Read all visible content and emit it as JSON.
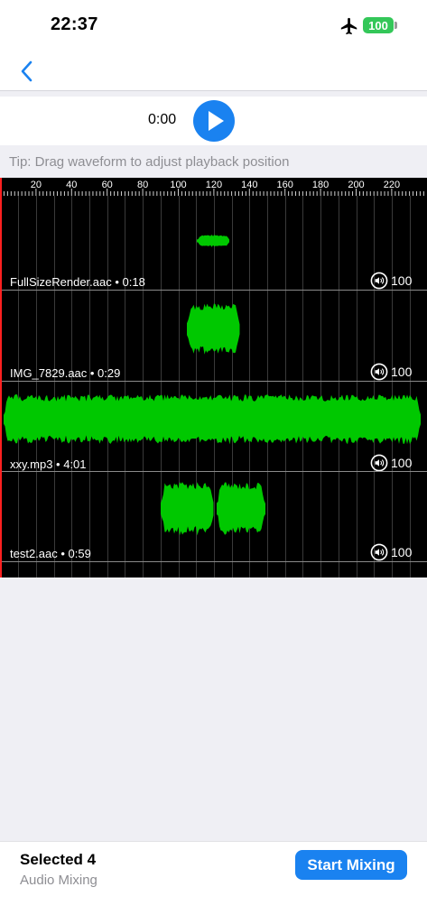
{
  "status_bar": {
    "time": "22:37",
    "battery": "100"
  },
  "player": {
    "time": "0:00"
  },
  "tip": "Tip: Drag waveform to adjust playback position",
  "ruler": {
    "labels": [
      "20",
      "40",
      "60",
      "80",
      "100",
      "120",
      "140",
      "160",
      "180",
      "200",
      "220"
    ]
  },
  "tracks": [
    {
      "name": "FullSizeRender.aac • 0:18",
      "volume": "100"
    },
    {
      "name": "IMG_7829.aac • 0:29",
      "volume": "100"
    },
    {
      "name": "xxy.mp3 • 4:01",
      "volume": "100"
    },
    {
      "name": "test2.aac • 0:59",
      "volume": "100"
    }
  ],
  "footer": {
    "selected": "Selected 4",
    "subtitle": "Audio Mixing",
    "action": "Start Mixing"
  },
  "colors": {
    "accent": "#1a82f0",
    "waveform": "#00c800",
    "playhead": "#ff2020",
    "battery": "#34c759"
  }
}
